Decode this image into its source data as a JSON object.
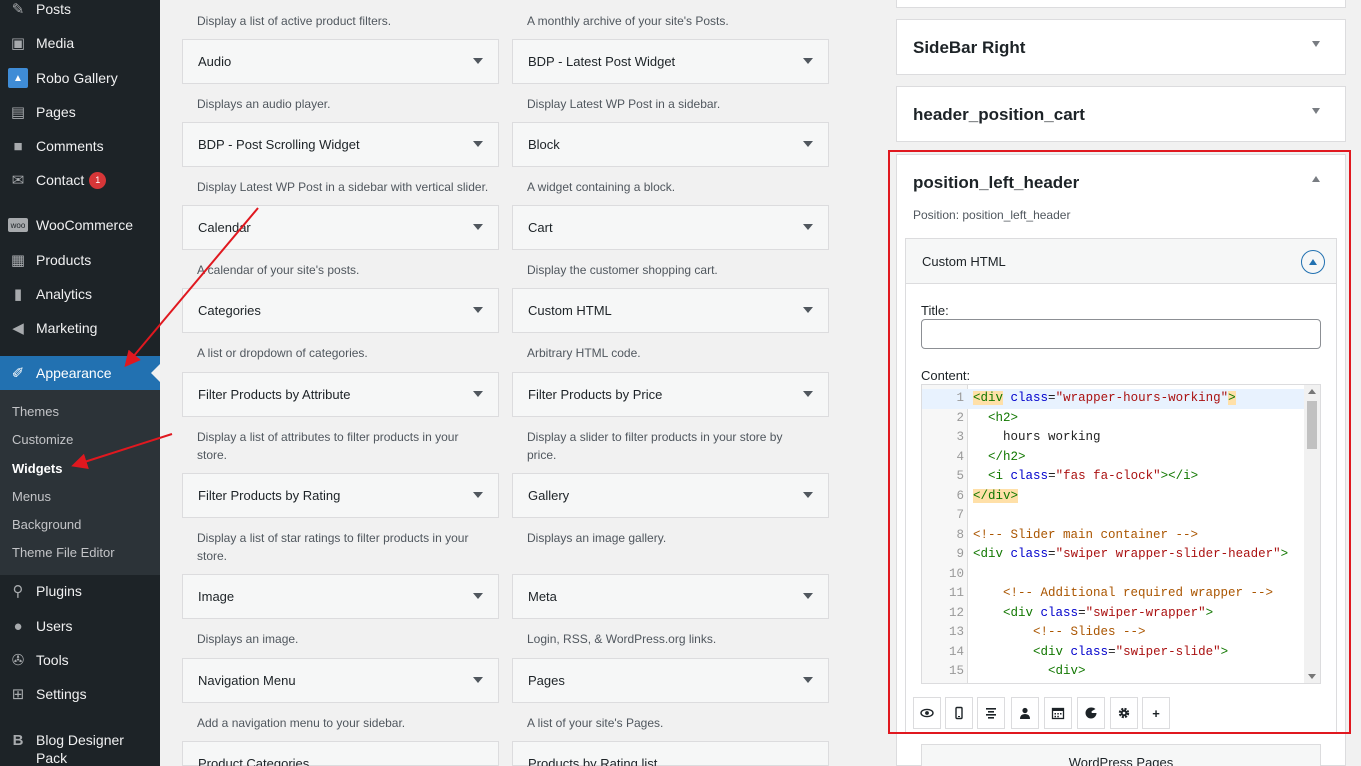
{
  "sidebar": {
    "items": [
      {
        "label": "Posts",
        "icon": "pin-icon"
      },
      {
        "label": "Media",
        "icon": "media-icon"
      },
      {
        "label": "Robo Gallery",
        "icon": "gallery-icon"
      },
      {
        "label": "Pages",
        "icon": "page-icon"
      },
      {
        "label": "Comments",
        "icon": "comment-icon"
      },
      {
        "label": "Contact",
        "icon": "mail-icon",
        "badge": "1"
      },
      {
        "label": "WooCommerce",
        "icon": "woo-icon"
      },
      {
        "label": "Products",
        "icon": "archive-icon"
      },
      {
        "label": "Analytics",
        "icon": "chart-icon"
      },
      {
        "label": "Marketing",
        "icon": "megaphone-icon"
      },
      {
        "label": "Appearance",
        "icon": "brush-icon"
      },
      {
        "label": "Plugins",
        "icon": "plugin-icon"
      },
      {
        "label": "Users",
        "icon": "user-icon"
      },
      {
        "label": "Tools",
        "icon": "wrench-icon"
      },
      {
        "label": "Settings",
        "icon": "settings-icon"
      },
      {
        "label": "Blog Designer Pack",
        "icon": "b-icon"
      }
    ],
    "submenu": [
      "Themes",
      "Customize",
      "Widgets",
      "Menus",
      "Background",
      "Theme File Editor"
    ]
  },
  "widgets": {
    "top_descs": [
      "Display a list of active product filters.",
      "A monthly archive of your site's Posts."
    ],
    "rows": [
      {
        "left": {
          "title": "Audio",
          "desc": "Displays an audio player."
        },
        "right": {
          "title": "BDP - Latest Post Widget",
          "desc": "Display Latest WP Post in a sidebar."
        }
      },
      {
        "left": {
          "title": "BDP - Post Scrolling Widget",
          "desc": "Display Latest WP Post in a sidebar with vertical slider."
        },
        "right": {
          "title": "Block",
          "desc": "A widget containing a block."
        }
      },
      {
        "left": {
          "title": "Calendar",
          "desc": "A calendar of your site's posts."
        },
        "right": {
          "title": "Cart",
          "desc": "Display the customer shopping cart."
        }
      },
      {
        "left": {
          "title": "Categories",
          "desc": "A list or dropdown of categories."
        },
        "right": {
          "title": "Custom HTML",
          "desc": "Arbitrary HTML code."
        }
      },
      {
        "left": {
          "title": "Filter Products by Attribute",
          "desc": "Display a list of attributes to filter products in your store."
        },
        "right": {
          "title": "Filter Products by Price",
          "desc": "Display a slider to filter products in your store by price."
        }
      },
      {
        "left": {
          "title": "Filter Products by Rating",
          "desc": "Display a list of star ratings to filter products in your store."
        },
        "right": {
          "title": "Gallery",
          "desc": "Displays an image gallery."
        }
      },
      {
        "left": {
          "title": "Image",
          "desc": "Displays an image."
        },
        "right": {
          "title": "Meta",
          "desc": "Login, RSS, & WordPress.org links."
        }
      },
      {
        "left": {
          "title": "Navigation Menu",
          "desc": "Add a navigation menu to your sidebar."
        },
        "right": {
          "title": "Pages",
          "desc": "A list of your site's Pages."
        }
      },
      {
        "left": {
          "title": "Product Categories",
          "desc": ""
        },
        "right": {
          "title": "Products by Rating list",
          "desc": ""
        }
      }
    ]
  },
  "areas": {
    "sidebar_right": "SideBar Right",
    "header_position_cart": "header_position_cart",
    "position_left_header": {
      "title": "position_left_header",
      "position_text": "Position: position_left_header",
      "widget": {
        "title": "Custom HTML",
        "title_label": "Title:",
        "title_value": "",
        "content_label": "Content:"
      }
    },
    "next_widget": "WordPress Pages"
  },
  "code_lines": [
    {
      "n": "1",
      "parts": [
        {
          "c": "t-tag t-match",
          "t": "<div"
        },
        {
          "c": "",
          "t": " "
        },
        {
          "c": "t-attr",
          "t": "class"
        },
        {
          "c": "",
          "t": "="
        },
        {
          "c": "t-str",
          "t": "\"wrapper-hours-working\""
        },
        {
          "c": "t-tag t-match",
          "t": ">"
        }
      ]
    },
    {
      "n": "2",
      "parts": [
        {
          "c": "",
          "t": "  "
        },
        {
          "c": "t-tag",
          "t": "<h2>"
        }
      ]
    },
    {
      "n": "3",
      "parts": [
        {
          "c": "",
          "t": "    hours working"
        }
      ]
    },
    {
      "n": "4",
      "parts": [
        {
          "c": "",
          "t": "  "
        },
        {
          "c": "t-tag",
          "t": "</h2>"
        }
      ]
    },
    {
      "n": "5",
      "parts": [
        {
          "c": "",
          "t": "  "
        },
        {
          "c": "t-tag",
          "t": "<i"
        },
        {
          "c": "",
          "t": " "
        },
        {
          "c": "t-attr",
          "t": "class"
        },
        {
          "c": "",
          "t": "="
        },
        {
          "c": "t-str",
          "t": "\"fas fa-clock\""
        },
        {
          "c": "t-tag",
          "t": "></i>"
        }
      ]
    },
    {
      "n": "6",
      "parts": [
        {
          "c": "t-tag t-match",
          "t": "</div>"
        }
      ]
    },
    {
      "n": "7",
      "parts": []
    },
    {
      "n": "8",
      "parts": [
        {
          "c": "t-com",
          "t": "<!-- Slider main container -->"
        }
      ]
    },
    {
      "n": "9",
      "parts": [
        {
          "c": "t-tag",
          "t": "<div"
        },
        {
          "c": "",
          "t": " "
        },
        {
          "c": "t-attr",
          "t": "class"
        },
        {
          "c": "",
          "t": "="
        },
        {
          "c": "t-str",
          "t": "\"swiper wrapper-slider-header\""
        },
        {
          "c": "t-tag",
          "t": ">"
        }
      ]
    },
    {
      "n": "10",
      "parts": []
    },
    {
      "n": "11",
      "parts": [
        {
          "c": "",
          "t": "    "
        },
        {
          "c": "t-com",
          "t": "<!-- Additional required wrapper -->"
        }
      ]
    },
    {
      "n": "12",
      "parts": [
        {
          "c": "",
          "t": "    "
        },
        {
          "c": "t-tag",
          "t": "<div"
        },
        {
          "c": "",
          "t": " "
        },
        {
          "c": "t-attr",
          "t": "class"
        },
        {
          "c": "",
          "t": "="
        },
        {
          "c": "t-str",
          "t": "\"swiper-wrapper\""
        },
        {
          "c": "t-tag",
          "t": ">"
        }
      ]
    },
    {
      "n": "13",
      "parts": [
        {
          "c": "",
          "t": "        "
        },
        {
          "c": "t-com",
          "t": "<!-- Slides -->"
        }
      ]
    },
    {
      "n": "14",
      "parts": [
        {
          "c": "",
          "t": "        "
        },
        {
          "c": "t-tag",
          "t": "<div"
        },
        {
          "c": "",
          "t": " "
        },
        {
          "c": "t-attr",
          "t": "class"
        },
        {
          "c": "",
          "t": "="
        },
        {
          "c": "t-str",
          "t": "\"swiper-slide\""
        },
        {
          "c": "t-tag",
          "t": ">"
        }
      ]
    },
    {
      "n": "15",
      "parts": [
        {
          "c": "",
          "t": "          "
        },
        {
          "c": "t-tag",
          "t": "<div>"
        }
      ]
    }
  ],
  "toolbar": [
    "eye-icon",
    "mobile-icon",
    "align-center-icon",
    "user-icon",
    "calendar-icon",
    "palette-icon",
    "gear-icon",
    "plus-icon"
  ],
  "colors": {
    "sidebar_bg": "#1d2327",
    "accent": "#2271b1",
    "highlight": "#e0181f"
  }
}
